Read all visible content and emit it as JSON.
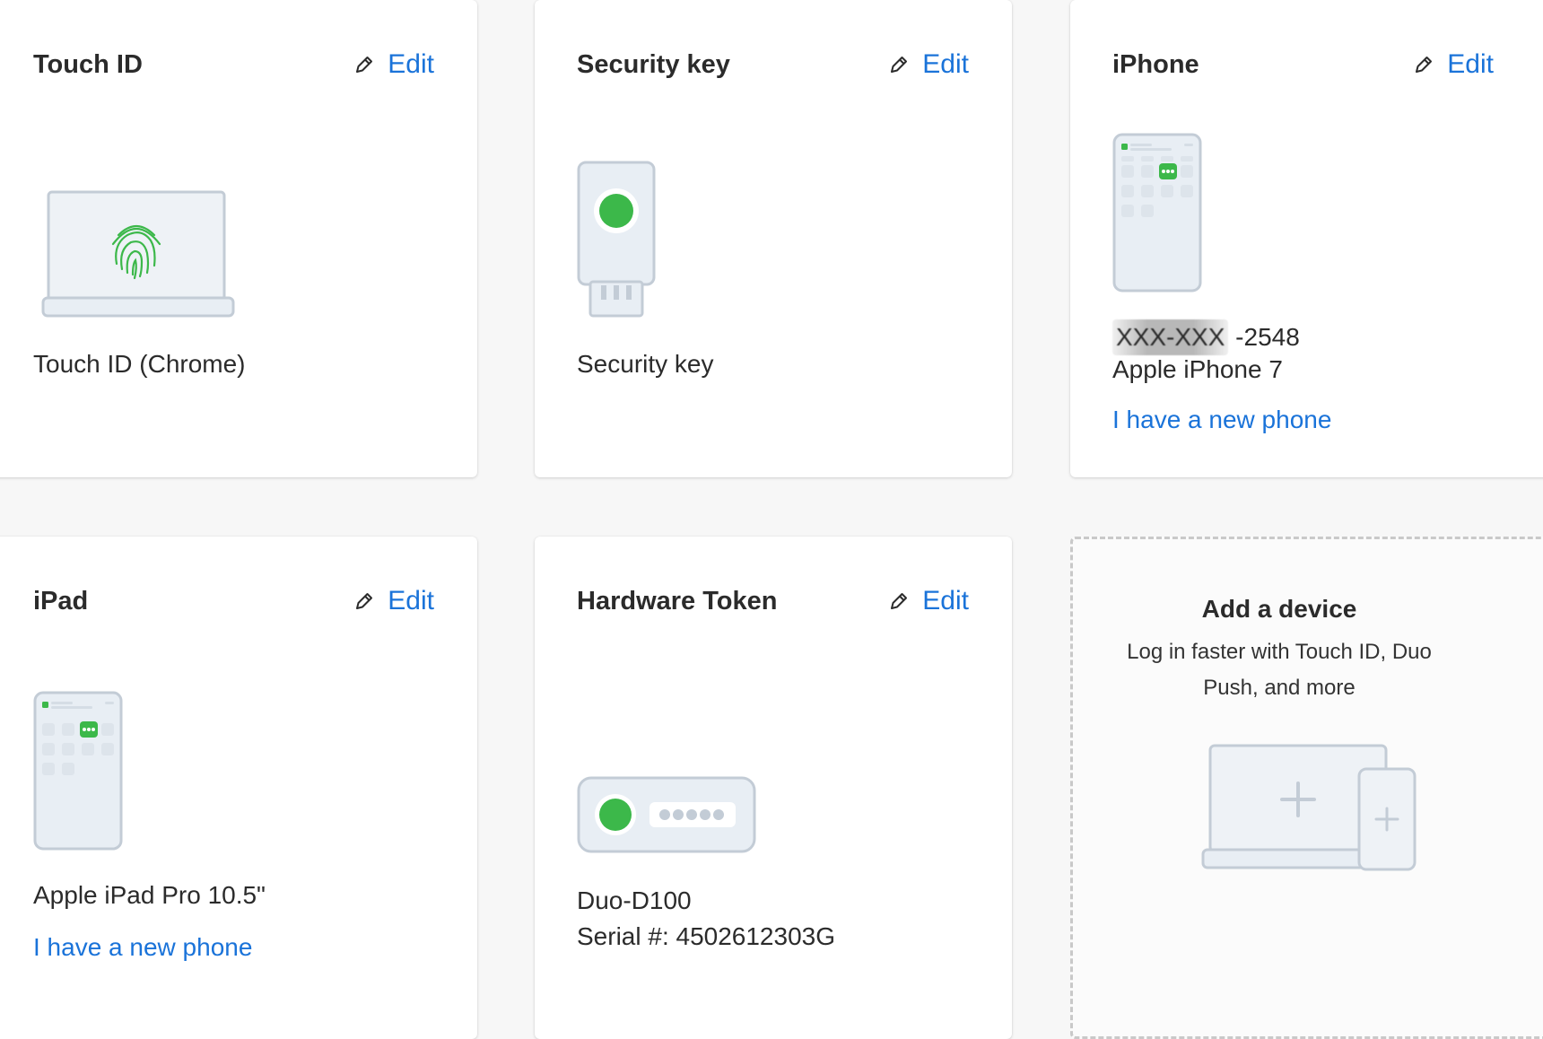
{
  "edit_label": "Edit",
  "colors": {
    "link": "#1a73d9",
    "accent_green": "#3cb84a",
    "device_outline": "#c3ccd6",
    "device_fill": "#e8eef4"
  },
  "cards": {
    "touch_id": {
      "title": "Touch ID",
      "device_name": "Touch ID (Chrome)",
      "icon": "laptop-fingerprint-icon"
    },
    "security_key": {
      "title": "Security key",
      "device_name": "Security key",
      "icon": "usb-security-key-icon"
    },
    "iphone": {
      "title": "iPhone",
      "phone_redacted": "XXX-XXX",
      "phone_suffix": " -2548",
      "device_name": "Apple iPhone 7",
      "new_phone_link": "I have a new phone",
      "icon": "phone-duo-app-icon"
    },
    "ipad": {
      "title": "iPad",
      "device_name": "Apple iPad Pro 10.5\"",
      "new_phone_link": "I have a new phone",
      "icon": "tablet-duo-app-icon"
    },
    "hardware_token": {
      "title": "Hardware Token",
      "device_name": "Duo-D100",
      "serial": "Serial #: 4502612303G",
      "icon": "hardware-token-icon"
    }
  },
  "add_device": {
    "title": "Add a device",
    "description": "Log in faster with Touch ID, Duo Push, and more",
    "icon": "add-laptop-phone-icon"
  }
}
